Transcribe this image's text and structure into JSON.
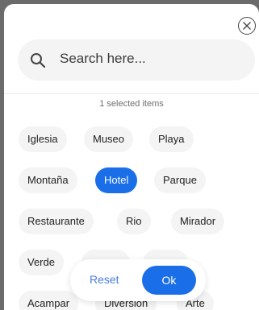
{
  "search": {
    "placeholder": "Search here..."
  },
  "selection": {
    "count_label": "1 selected items"
  },
  "chips": [
    {
      "label": "Iglesia",
      "selected": false
    },
    {
      "label": "Museo",
      "selected": false
    },
    {
      "label": "Playa",
      "selected": false
    },
    {
      "label": "Montaña",
      "selected": false
    },
    {
      "label": "Hotel",
      "selected": true
    },
    {
      "label": "Parque",
      "selected": false
    },
    {
      "label": "Restaurante",
      "selected": false
    },
    {
      "label": "Rio",
      "selected": false
    },
    {
      "label": "Mirador",
      "selected": false
    },
    {
      "label": "Verde",
      "selected": false
    },
    {
      "label": "",
      "selected": false
    },
    {
      "label": "",
      "selected": false
    },
    {
      "label": "Acampar",
      "selected": false
    },
    {
      "label": "Diversion",
      "selected": false
    },
    {
      "label": "Arte",
      "selected": false
    }
  ],
  "actions": {
    "reset_label": "Reset",
    "ok_label": "Ok"
  },
  "colors": {
    "accent": "#1a6fe8",
    "reset_text": "#4a7de0",
    "chip_bg": "#f4f4f4",
    "overlay": "#6b6b6b"
  },
  "icons": {
    "close": "close-circle-icon",
    "search": "magnifier-icon"
  }
}
